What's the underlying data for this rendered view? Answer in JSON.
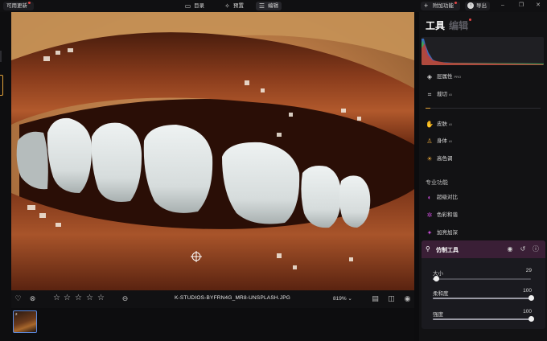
{
  "topbar": {
    "update_label": "可用更新",
    "tabs": [
      {
        "label": "目录",
        "icon": "folder-icon"
      },
      {
        "label": "预置",
        "icon": "presets-icon"
      },
      {
        "label": "编辑",
        "icon": "sliders-icon"
      }
    ],
    "addons_label": "附加功能",
    "export_label": "导出"
  },
  "bottombar": {
    "filename": "K-STUDIOS-BYFRN4G_MR8-UNSPLASH.JPG",
    "zoom": "819%",
    "rating_stars": 5
  },
  "filmstrip": {
    "thumb_index": "2"
  },
  "panel": {
    "title_tools": "工具",
    "title_edit": "编辑",
    "tools": [
      {
        "label": "层属性",
        "badge": "PRO",
        "icon": "layers-icon"
      },
      {
        "label": "裁切",
        "badge": "AI",
        "icon": "crop-icon"
      }
    ],
    "ai_tools": [
      {
        "label": "皮肤",
        "badge": "AI",
        "icon": "skin-icon",
        "color": "#e2a23a"
      },
      {
        "label": "身体",
        "badge": "AI",
        "icon": "body-icon",
        "color": "#e2a23a"
      },
      {
        "label": "高色调",
        "badge": "",
        "icon": "tone-icon",
        "color": "#e2a23a"
      }
    ],
    "pro_section_label": "专业功能",
    "pro_tools": [
      {
        "label": "超级对比",
        "icon": "contrast-icon",
        "color": "#c34bd1"
      },
      {
        "label": "色彩和谐",
        "icon": "color-harmony-icon",
        "color": "#c34bd1"
      },
      {
        "label": "加亮加深",
        "icon": "dodge-burn-icon",
        "color": "#c34bd1"
      }
    ],
    "heal_tool": {
      "label": "仿制工具",
      "sliders": [
        {
          "label": "大小",
          "value": "29",
          "level": 0.04
        },
        {
          "label": "柔和度",
          "value": "100",
          "level": 1.0
        },
        {
          "label": "强度",
          "value": "100",
          "level": 1.0
        }
      ]
    }
  },
  "colors": {
    "accent_orange": "#e2a23a",
    "accent_purple": "#c34bd1",
    "selection_blue": "#5b8ae0"
  }
}
